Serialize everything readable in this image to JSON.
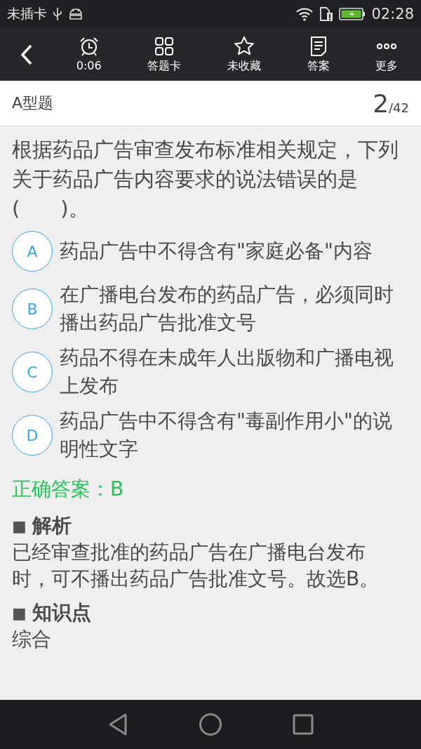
{
  "status_bar": {
    "carrier": "未插卡",
    "time": "02:28"
  },
  "toolbar": {
    "items": [
      {
        "kind": "timer",
        "label": "0:06"
      },
      {
        "kind": "grid",
        "label": "答题卡"
      },
      {
        "kind": "star",
        "label": "未收藏"
      },
      {
        "kind": "doc",
        "label": "答案"
      },
      {
        "kind": "more",
        "label": "更多"
      }
    ]
  },
  "header": {
    "type_label": "A型题",
    "current": "2",
    "total": "/42"
  },
  "question": "根据药品广告审查发布标准相关规定，下列关于药品广告内容要求的说法错误的是(　　)。",
  "options": [
    {
      "letter": "A",
      "text": "药品广告中不得含有\"家庭必备\"内容",
      "selected": false
    },
    {
      "letter": "B",
      "text": "在广播电台发布的药品广告，必须同时播出药品广告批准文号",
      "selected": false
    },
    {
      "letter": "C",
      "text": "药品不得在未成年人出版物和广播电视上发布",
      "selected": false
    },
    {
      "letter": "D",
      "text": "药品广告中不得含有\"毒副作用小\"的说明性文字",
      "selected": false
    }
  ],
  "answer": "正确答案：B",
  "sections": [
    {
      "marker": "■",
      "title": "解析",
      "body": "已经审查批准的药品广告在广播电台发布时，可不播出药品广告批准文号。故选B。"
    },
    {
      "marker": "■",
      "title": "知识点",
      "body": "综合"
    }
  ]
}
